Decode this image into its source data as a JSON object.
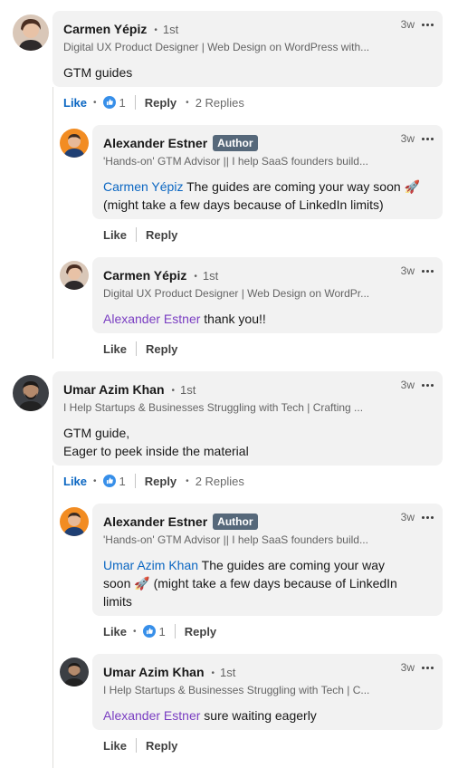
{
  "comments": [
    {
      "name": "Carmen Yépiz",
      "degree": "1st",
      "headline": "Digital UX Product Designer | Web Design on WordPress with...",
      "time": "3w",
      "text": "GTM guides",
      "actions": {
        "like": "Like",
        "reactions": "1",
        "reply": "Reply",
        "replies": "2 Replies"
      },
      "replies": [
        {
          "name": "Alexander Estner",
          "badge": "Author",
          "headline": "'Hands-on' GTM Advisor || I help SaaS founders build...",
          "time": "3w",
          "mention": "Carmen Yépiz",
          "text": " The guides are coming your way soon 🚀 (might take a few days because of LinkedIn limits)",
          "actions": {
            "like": "Like",
            "reply": "Reply"
          }
        },
        {
          "name": "Carmen Yépiz",
          "degree": "1st",
          "headline": "Digital UX Product Designer | Web Design on WordPr...",
          "time": "3w",
          "mention": "Alexander Estner",
          "text": " thank you!!",
          "actions": {
            "like": "Like",
            "reply": "Reply"
          }
        }
      ]
    },
    {
      "name": "Umar Azim Khan",
      "degree": "1st",
      "headline": "I Help Startups & Businesses Struggling with Tech | Crafting ...",
      "time": "3w",
      "text_line1": "GTM guide,",
      "text_line2": "Eager to peek inside the material",
      "actions": {
        "like": "Like",
        "reactions": "1",
        "reply": "Reply",
        "replies": "2 Replies"
      },
      "replies": [
        {
          "name": "Alexander Estner",
          "badge": "Author",
          "headline": "'Hands-on' GTM Advisor || I help SaaS founders build...",
          "time": "3w",
          "mention": "Umar Azim Khan",
          "text": " The guides are coming your way soon 🚀 (might take a few days because of LinkedIn limits",
          "actions": {
            "like": "Like",
            "reactions": "1",
            "reply": "Reply"
          }
        },
        {
          "name": "Umar Azim Khan",
          "degree": "1st",
          "headline": "I Help Startups & Businesses Struggling with Tech | C...",
          "time": "3w",
          "mention": "Alexander Estner",
          "text": " sure waiting eagerly",
          "actions": {
            "like": "Like",
            "reply": "Reply"
          }
        }
      ]
    }
  ],
  "colors": {
    "link_blue": "#0a66c2",
    "mention_purple": "#7a3ec2",
    "bubble_bg": "#f2f2f2",
    "author_badge": "#56687a"
  },
  "icons": {
    "reaction": "like-thumb-icon",
    "more": "more-options-icon"
  }
}
